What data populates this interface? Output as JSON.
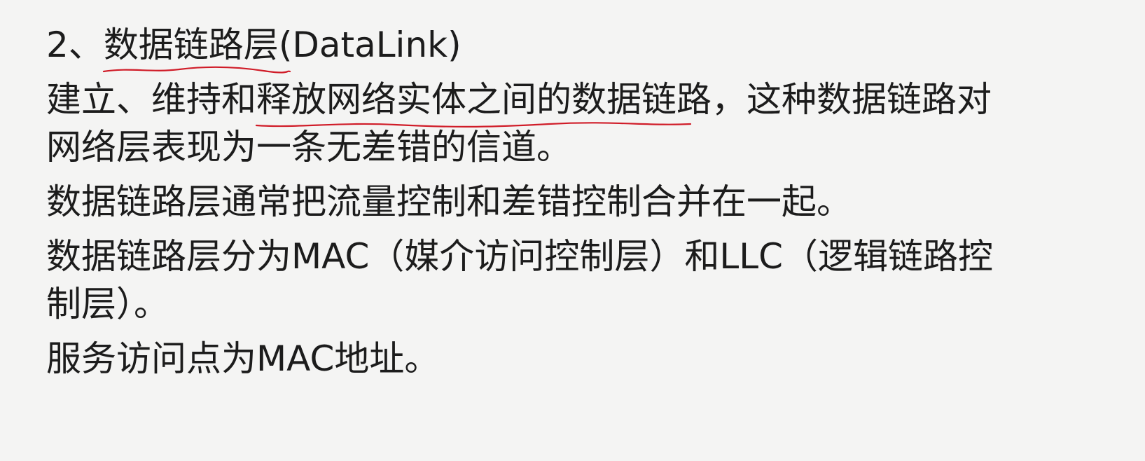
{
  "heading": {
    "prefix": "2、",
    "highlight": "数据链路层",
    "suffix": "(DataLink)"
  },
  "paragraph1": {
    "pre": "建立、维持和",
    "highlight": "释放网络实体之间的数据链",
    "post": "路，这种数据链路对",
    "line2": "网络层表现为一条无差错的信道。"
  },
  "paragraph2": "数据链路层通常把流量控制和差错控制合并在一起。",
  "paragraph3": {
    "line1": "数据链路层分为MAC（媒介访问控制层）和LLC（逻辑链路控",
    "line2": "制层）。"
  },
  "paragraph4": "服务访问点为MAC地址。",
  "colors": {
    "background": "#f4f4f3",
    "text": "#1c1c1c",
    "annotation": "#d01c28"
  }
}
